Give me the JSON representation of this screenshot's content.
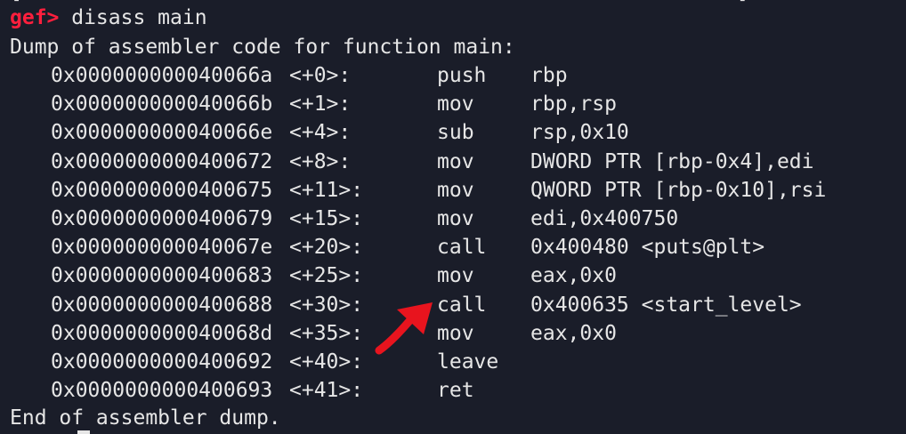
{
  "terminal": {
    "top_cutoff_text": "[                                                          ]",
    "prompt": "gef>",
    "command": " disass main",
    "header": "Dump of assembler code for function main:",
    "footer": "End of assembler dump."
  },
  "disassembly": [
    {
      "address": "0x000000000040066a",
      "offset": "<+0>:",
      "mnemonic": "push",
      "operands": "rbp"
    },
    {
      "address": "0x000000000040066b",
      "offset": "<+1>:",
      "mnemonic": "mov",
      "operands": "rbp,rsp"
    },
    {
      "address": "0x000000000040066e",
      "offset": "<+4>:",
      "mnemonic": "sub",
      "operands": "rsp,0x10"
    },
    {
      "address": "0x0000000000400672",
      "offset": "<+8>:",
      "mnemonic": "mov",
      "operands": "DWORD PTR [rbp-0x4],edi"
    },
    {
      "address": "0x0000000000400675",
      "offset": "<+11>:",
      "mnemonic": "mov",
      "operands": "QWORD PTR [rbp-0x10],rsi"
    },
    {
      "address": "0x0000000000400679",
      "offset": "<+15>:",
      "mnemonic": "mov",
      "operands": "edi,0x400750"
    },
    {
      "address": "0x000000000040067e",
      "offset": "<+20>:",
      "mnemonic": "call",
      "operands": "0x400480 <puts@plt>"
    },
    {
      "address": "0x0000000000400683",
      "offset": "<+25>:",
      "mnemonic": "mov",
      "operands": "eax,0x0"
    },
    {
      "address": "0x0000000000400688",
      "offset": "<+30>:",
      "mnemonic": "call",
      "operands": "0x400635 <start_level>"
    },
    {
      "address": "0x000000000040068d",
      "offset": "<+35>:",
      "mnemonic": "mov",
      "operands": "eax,0x0"
    },
    {
      "address": "0x0000000000400692",
      "offset": "<+40>:",
      "mnemonic": "leave",
      "operands": ""
    },
    {
      "address": "0x0000000000400693",
      "offset": "<+41>:",
      "mnemonic": "ret",
      "operands": ""
    }
  ],
  "annotation": {
    "icon": "red-arrow-icon",
    "color": "#e8141e",
    "points_to_row": 8
  },
  "colors": {
    "background": "#1a1d29",
    "text": "#e6e6e6",
    "prompt": "#ff1f3d"
  }
}
